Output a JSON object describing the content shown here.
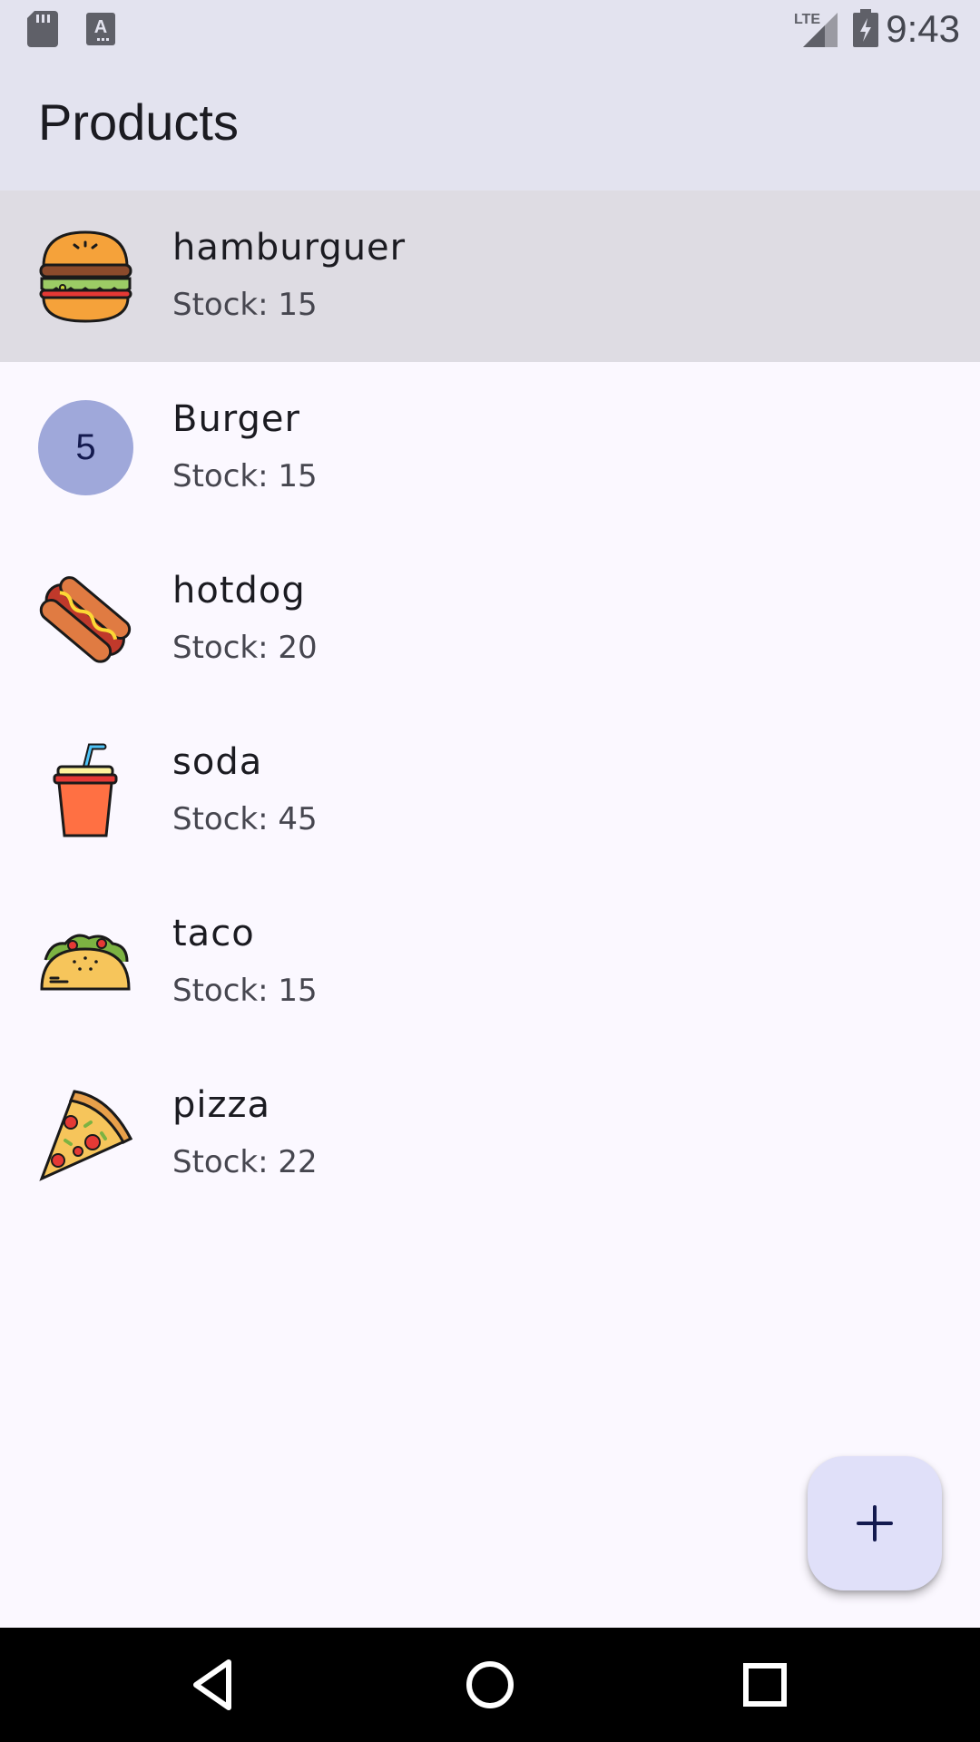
{
  "status_bar": {
    "time": "9:43",
    "icons": [
      "sd-card-icon",
      "keyboard-a-icon",
      "lte-signal-icon",
      "battery-charging-icon"
    ]
  },
  "app_bar": {
    "title": "Products"
  },
  "products": [
    {
      "name": "hamburguer",
      "stock": "Stock: 15",
      "icon": "hamburger-icon"
    },
    {
      "name": "Burger",
      "stock": "Stock: 15",
      "avatar_text": "5"
    },
    {
      "name": "hotdog",
      "stock": "Stock: 20",
      "icon": "hotdog-icon"
    },
    {
      "name": "soda",
      "stock": "Stock: 45",
      "icon": "soda-icon"
    },
    {
      "name": "taco",
      "stock": "Stock: 15",
      "icon": "taco-icon"
    },
    {
      "name": "pizza",
      "stock": "Stock: 22",
      "icon": "pizza-icon"
    }
  ],
  "fab": {
    "icon": "plus-icon"
  },
  "nav_bar": {
    "buttons": [
      "back-icon",
      "home-icon",
      "recents-icon"
    ]
  },
  "colors": {
    "app_bar_bg": "#e3e3ef",
    "page_bg": "#fbf8ff",
    "highlight_bg": "#dedce3",
    "avatar_bg": "#9fa8da",
    "fab_bg": "#e0e0f9"
  }
}
